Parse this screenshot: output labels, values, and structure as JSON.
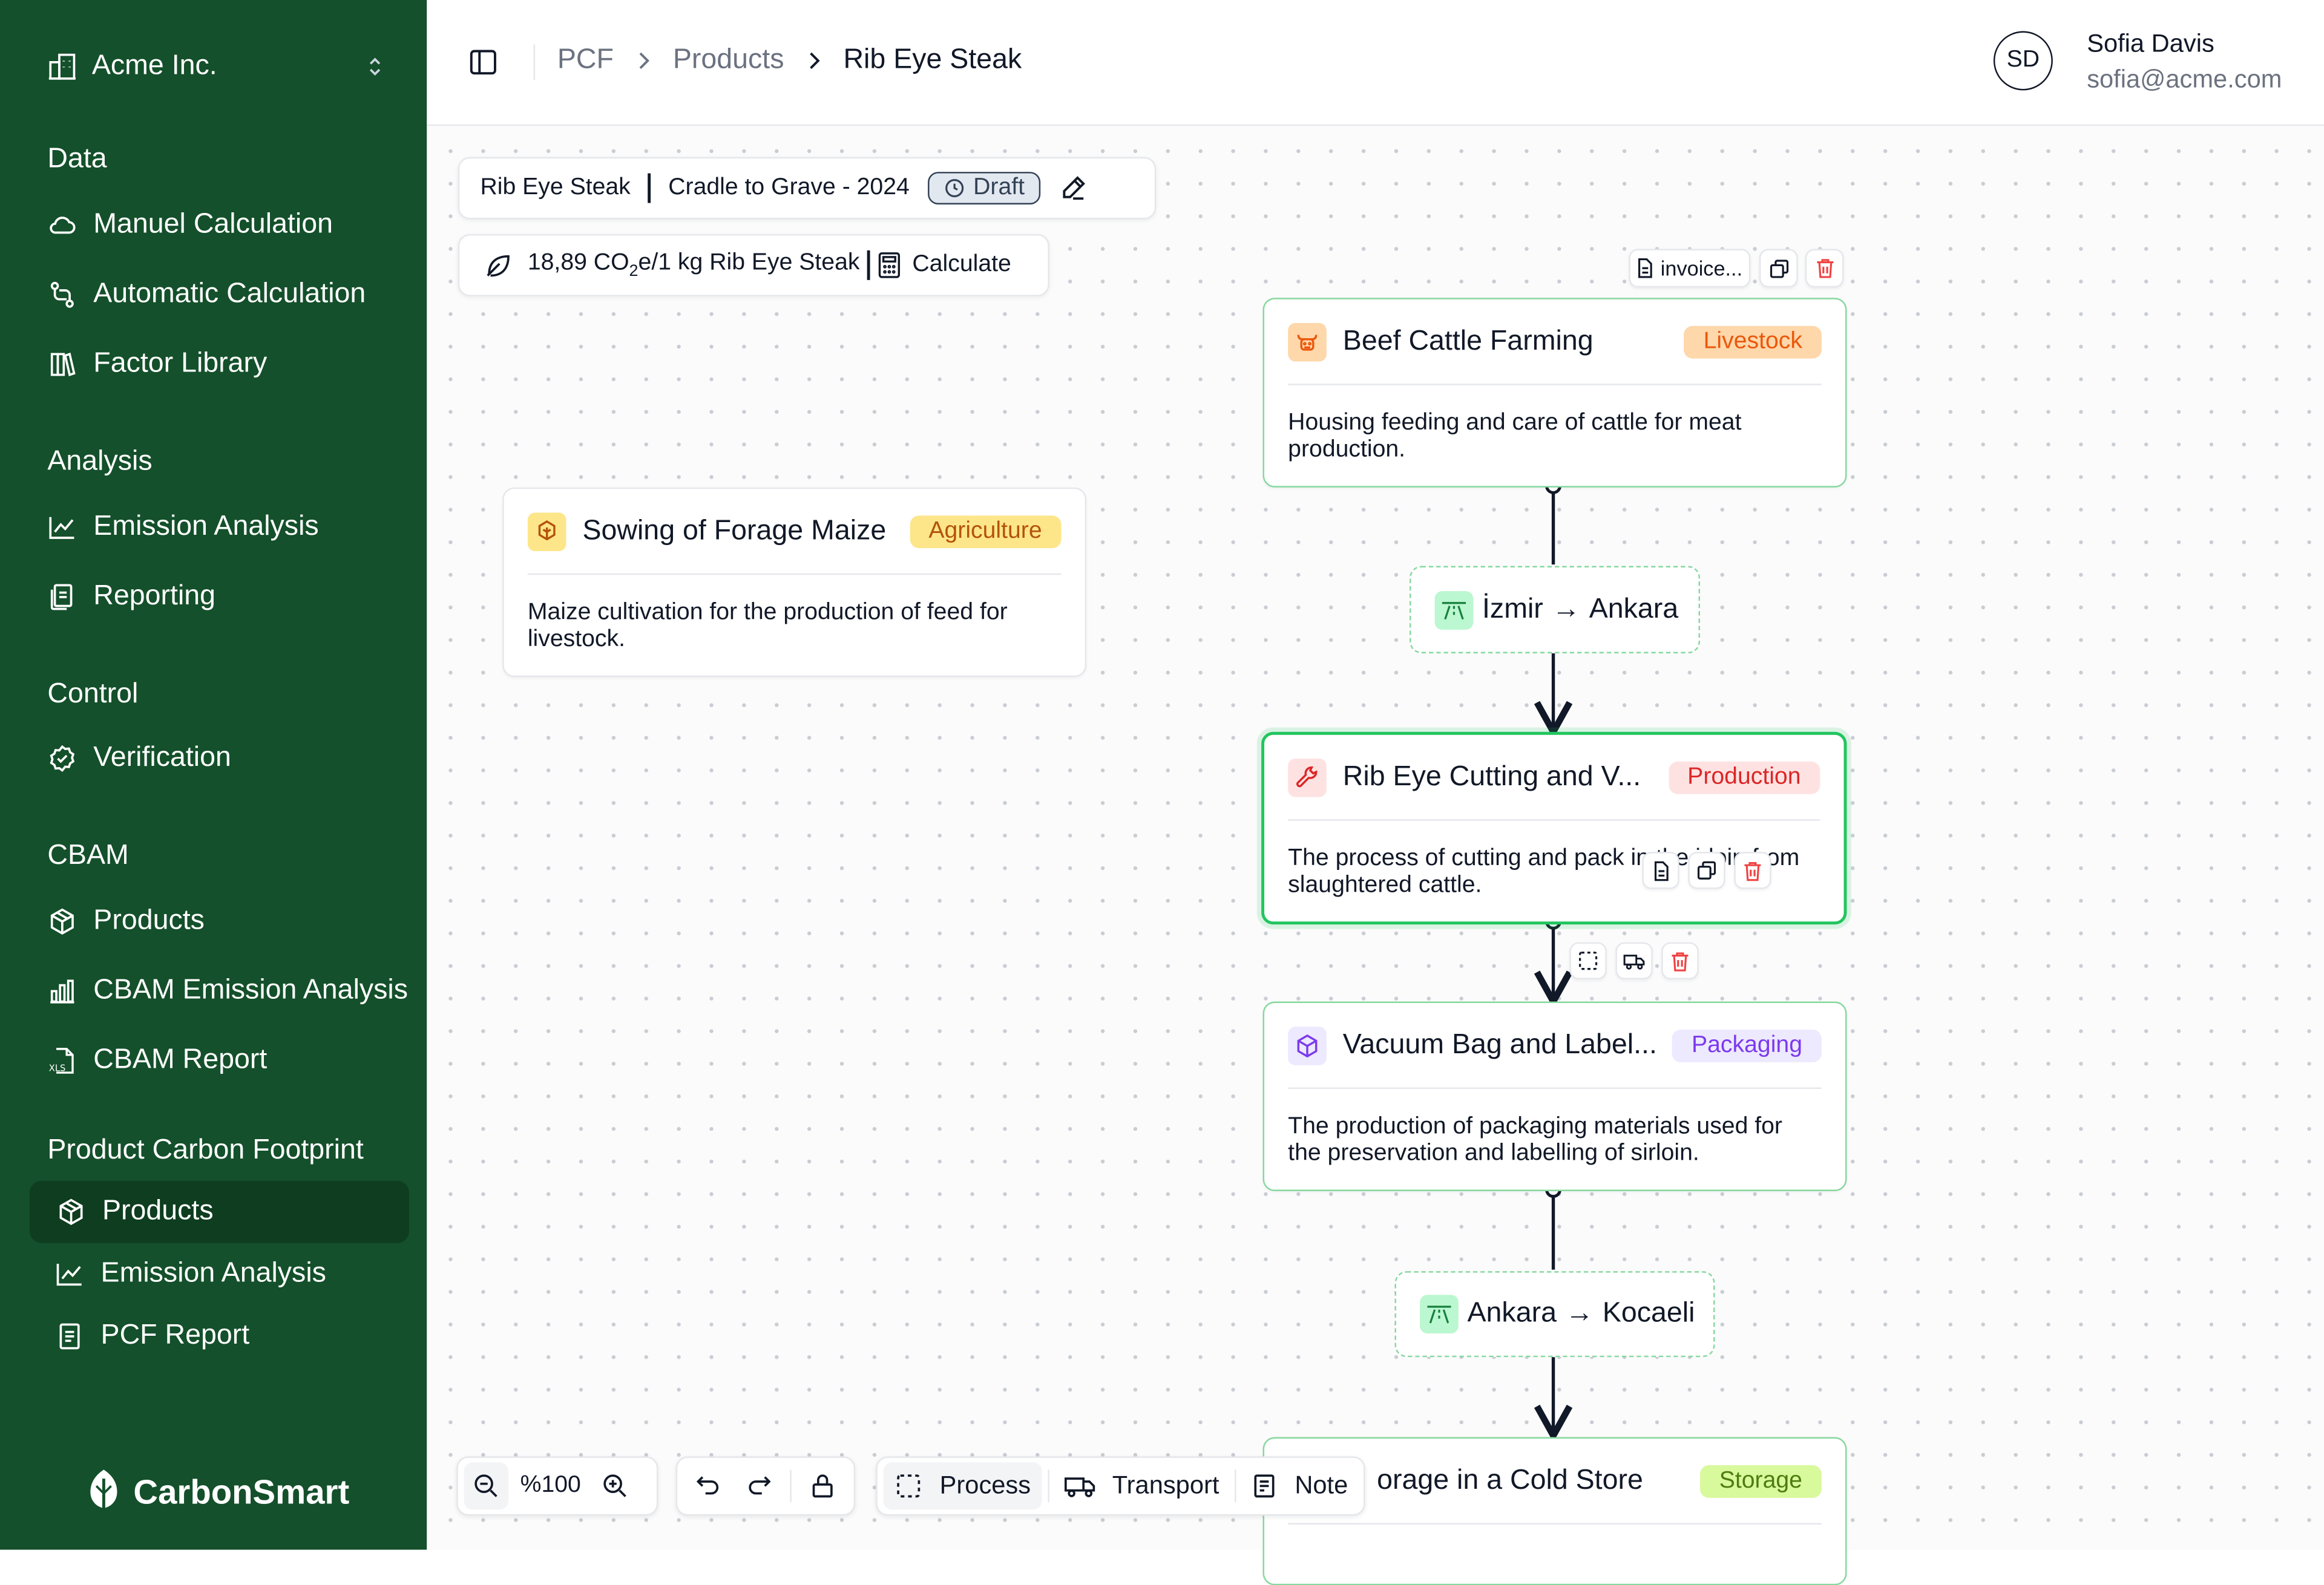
{
  "sidebar": {
    "org_name": "Acme Inc.",
    "sections": {
      "data": {
        "title": "Data",
        "items": [
          "Manuel Calculation",
          "Automatic Calculation",
          "Factor Library"
        ]
      },
      "analysis": {
        "title": "Analysis",
        "items": [
          "Emission Analysis",
          "Reporting"
        ]
      },
      "control": {
        "title": "Control",
        "items": [
          "Verification"
        ]
      },
      "cbam": {
        "title": "CBAM",
        "items": [
          "Products",
          "CBAM Emission Analysis",
          "CBAM Report"
        ]
      },
      "pcf": {
        "title": "Product Carbon Footprint",
        "items": [
          "Products",
          "Emission Analysis",
          "PCF Report"
        ],
        "active": "Products"
      }
    },
    "brand": "CarbonSmart"
  },
  "header": {
    "breadcrumb": [
      "PCF",
      "Products",
      "Rib Eye Steak"
    ],
    "user": {
      "initials": "SD",
      "name": "Sofia Davis",
      "email": "sofia@acme.com"
    }
  },
  "canvas": {
    "info_bar": {
      "product": "Rib Eye Steak",
      "scope": "Cradle to Grave - 2024",
      "status": "Draft"
    },
    "calc_bar": {
      "result_prefix": "18,89 CO",
      "result_sub": "2",
      "result_suffix": "e/1 kg Rib Eye Steak",
      "button": "Calculate"
    },
    "node_actions": {
      "invoice_label": "invoice..."
    },
    "nodes": {
      "maize": {
        "title": "Sowing of Forage Maize",
        "tag": "Agriculture",
        "description": "Maize cultivation for the production of feed for livestock."
      },
      "cattle": {
        "title": "Beef Cattle Farming",
        "tag": "Livestock",
        "description": "Housing feeding and care of cattle for meat production."
      },
      "cutting": {
        "title": "Rib Eye Cutting and V...",
        "tag": "Production",
        "description": "The process of cutting and pack  in  the  irloin from slaughtered cattle."
      },
      "vacuum": {
        "title": "Vacuum Bag and Label...",
        "tag": "Packaging",
        "description": "The production of packaging materials used for the preservation and labelling of sirloin."
      },
      "storage": {
        "title": "orage in a Cold Store",
        "tag": "Storage"
      }
    },
    "transports": {
      "t1": {
        "from": "İzmir",
        "to": "Ankara",
        "arrow": "→"
      },
      "t2": {
        "from": "Ankara",
        "to": "Kocaeli",
        "arrow": "→"
      }
    },
    "toolbar": {
      "zoom": "%100",
      "process": "Process",
      "transport": "Transport",
      "note": "Note"
    }
  },
  "colors": {
    "sidebar_bg": "#14502b",
    "sidebar_active": "#0e3d1f",
    "agriculture": "#fde68a",
    "livestock": "#fed7aa",
    "production": "#fee2e2",
    "packaging": "#ede9fe",
    "storage": "#d9f99d",
    "accent_green": "#22c55e"
  }
}
